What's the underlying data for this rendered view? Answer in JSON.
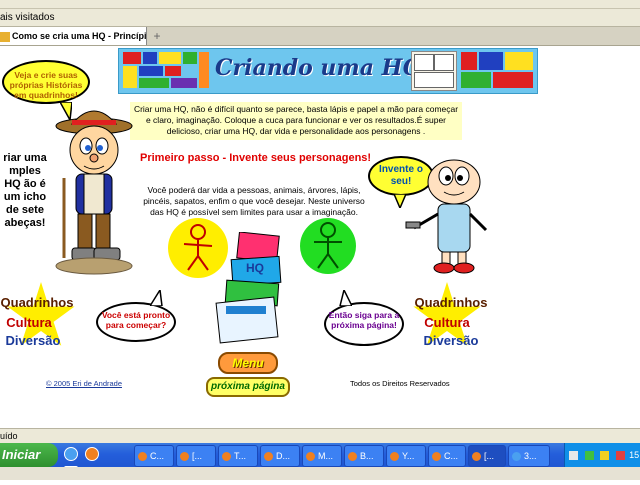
{
  "browser": {
    "bookmarks_label": "ais visitados",
    "tab_title": "Como se cria uma HQ - Princípio básico",
    "new_tab_glyph": "+",
    "status_text": "uído"
  },
  "banner": {
    "title": "Criando uma HQ"
  },
  "intro": {
    "text": "Criar uma HQ, não é difícil quanto se parece, basta lápis e papel a mão para começar e claro, imaginação. Coloque a cuca para funcionar e ver os resultados.É super delicioso, criar uma HQ, dar vida e personalidade aos personagens ."
  },
  "left_speech": {
    "text": "Veja e crie suas próprias Histórias em quadrinhos!"
  },
  "left_side_text": "riar uma mples HQ ão é um icho de sete abeças!",
  "step": {
    "title": "Primeiro passo - Invente seus personagens!",
    "text": "Você poderá dar vida a pessoas, animais, árvores, lápis, pincéis, sapatos, enfim o que você desejar. Neste universo das HQ é possível sem limites para usar a imaginação."
  },
  "right_speech": {
    "text": "Invente o seu!"
  },
  "stars_left": {
    "line1": "Quadrinhos",
    "line2": "Cultura",
    "line3": "Diversão"
  },
  "stars_right": {
    "line1": "Quadrinhos",
    "line2": "Cultura",
    "line3": "Diversão"
  },
  "bubble_left": {
    "text": "Você está pronto para começar?"
  },
  "bubble_right": {
    "text": "Então siga para a próxima página!"
  },
  "books": {
    "label": "HQ"
  },
  "nav": {
    "menu_label": "Menu",
    "next_label": "próxima página"
  },
  "footer": {
    "copyright": "© 2005 Eri de Andrade",
    "rights": "Todos os Direitos Reservados"
  },
  "taskbar": {
    "start_label": "Iniciar",
    "items": [
      {
        "label": "C..."
      },
      {
        "label": "[..."
      },
      {
        "label": "T..."
      },
      {
        "label": "D..."
      },
      {
        "label": "M..."
      },
      {
        "label": "B..."
      },
      {
        "label": "Y..."
      },
      {
        "label": "C..."
      },
      {
        "label": "[..."
      },
      {
        "label": "3..."
      }
    ],
    "clock": "15"
  },
  "colors": {
    "accent_red": "#e00000",
    "banner_blue": "#6ec6ee",
    "xp_blue": "#245edb"
  }
}
